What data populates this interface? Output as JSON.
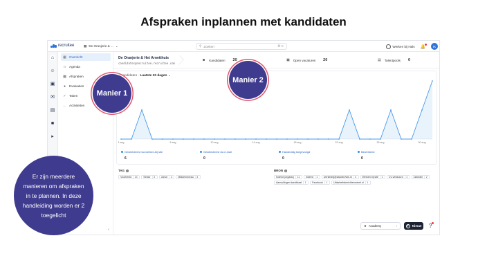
{
  "headline": "Afspraken inplannen met kandidaten",
  "topbar": {
    "logo_text": "recruitee",
    "company_switch": "De Oranjerie & ...",
    "search_placeholder": "Zoeken",
    "search_shortcut": "⌘ K",
    "company_link": "Werken bij Hals",
    "avatar_initials": "IK"
  },
  "subnav": {
    "items": [
      {
        "label": "Overzicht",
        "icon": "grid-icon",
        "active": true
      },
      {
        "label": "Agenda",
        "icon": "calendar-icon",
        "active": false
      },
      {
        "label": "Afspraken",
        "icon": "appointments-icon",
        "active": false
      },
      {
        "label": "Evaluaties",
        "icon": "evaluations-icon",
        "active": false
      },
      {
        "label": "Taken",
        "icon": "check-icon",
        "active": false
      },
      {
        "label": "Activiteiten",
        "icon": "activity-icon",
        "active": false
      }
    ]
  },
  "company": {
    "name": "De Oranjerie & Het Arnetthuis",
    "email": "candidates@recruitee.recruitee.com"
  },
  "stats": [
    {
      "label": "Kandidaten",
      "value": "20",
      "icon": "user-icon"
    },
    {
      "label": "Open vacatures",
      "value": "20",
      "icon": "briefcase-icon"
    },
    {
      "label": "Talentpools",
      "value": "0",
      "icon": "chart-icon"
    }
  ],
  "chart_header": {
    "label": "Kandidaten",
    "range": "Laatste 30 dagen"
  },
  "chart_data": {
    "type": "area",
    "x": [
      "1 aug",
      "2 aug",
      "3 aug",
      "4 aug",
      "5 aug",
      "6 aug",
      "7 aug",
      "8 aug",
      "9 aug",
      "10 aug",
      "11 aug",
      "12 aug",
      "13 aug",
      "14 aug",
      "15 aug",
      "16 aug",
      "17 aug",
      "18 aug",
      "19 aug",
      "20 aug",
      "21 aug",
      "22 aug",
      "23 aug",
      "24 aug",
      "25 aug",
      "26 aug",
      "27 aug",
      "28 aug",
      "29 aug",
      "30 aug",
      "31 aug"
    ],
    "tick_labels": [
      "1 aug",
      "6 aug",
      "10 aug",
      "14 aug",
      "18 aug",
      "22 aug",
      "26 aug",
      "30 aug"
    ],
    "series": [
      {
        "values": [
          0,
          0,
          1,
          0,
          0,
          0,
          0,
          0,
          0,
          0,
          0,
          0,
          0,
          0,
          0,
          0,
          0,
          0,
          0,
          0,
          0,
          0,
          1,
          0,
          0,
          0,
          1,
          0,
          0,
          1,
          2
        ]
      }
    ],
    "grid": false,
    "color": "#4a9ae8"
  },
  "legend": [
    {
      "label": "Geselecteerd via werken-bij site",
      "value": "6"
    },
    {
      "label": "Geselecteerd via e-mail",
      "value": "0"
    },
    {
      "label": "Handmatig toegevoegd",
      "value": "0"
    },
    {
      "label": "Bewerkend",
      "value": "0"
    }
  ],
  "tags": {
    "title": "TAG",
    "chips": [
      {
        "label": "Voorbeeld",
        "count": "14"
      },
      {
        "label": "Senior",
        "count": "3"
      },
      {
        "label": "Junior",
        "count": "4"
      },
      {
        "label": "Middenniveau",
        "count": "4"
      }
    ]
  },
  "sources": {
    "title": "BRON",
    "chips": [
      {
        "label": "Indeed (organic)",
        "count": "11"
      },
      {
        "label": "Indeed",
        "count": "1"
      },
      {
        "label": "werkenbij@sandervwls.nl",
        "count": "4"
      },
      {
        "label": "Werken bij site",
        "count": "1"
      },
      {
        "label": "Cv-verstuurd",
        "count": "1"
      },
      {
        "label": "LinkedIn",
        "count": "2"
      },
      {
        "label": "Aanvullingen kandidaat",
        "count": "1"
      },
      {
        "label": "Facebook",
        "count": "1"
      },
      {
        "label": "Ubiarbeitsberichtenmerel.nl",
        "count": "1"
      }
    ]
  },
  "bottom": {
    "academy_label": "Academy",
    "new_label": "Nieuw",
    "help": "?"
  },
  "annotations": {
    "manier1": "Manier 1",
    "manier2": "Manier 2",
    "callout": "Er zijn meerdere manieren om afspraken in te plannen. In deze handleiding worden er 2 toegelicht"
  },
  "colors": {
    "accent": "#2f73d8",
    "badge": "#3f3b8f",
    "ring": "#e0566c"
  }
}
